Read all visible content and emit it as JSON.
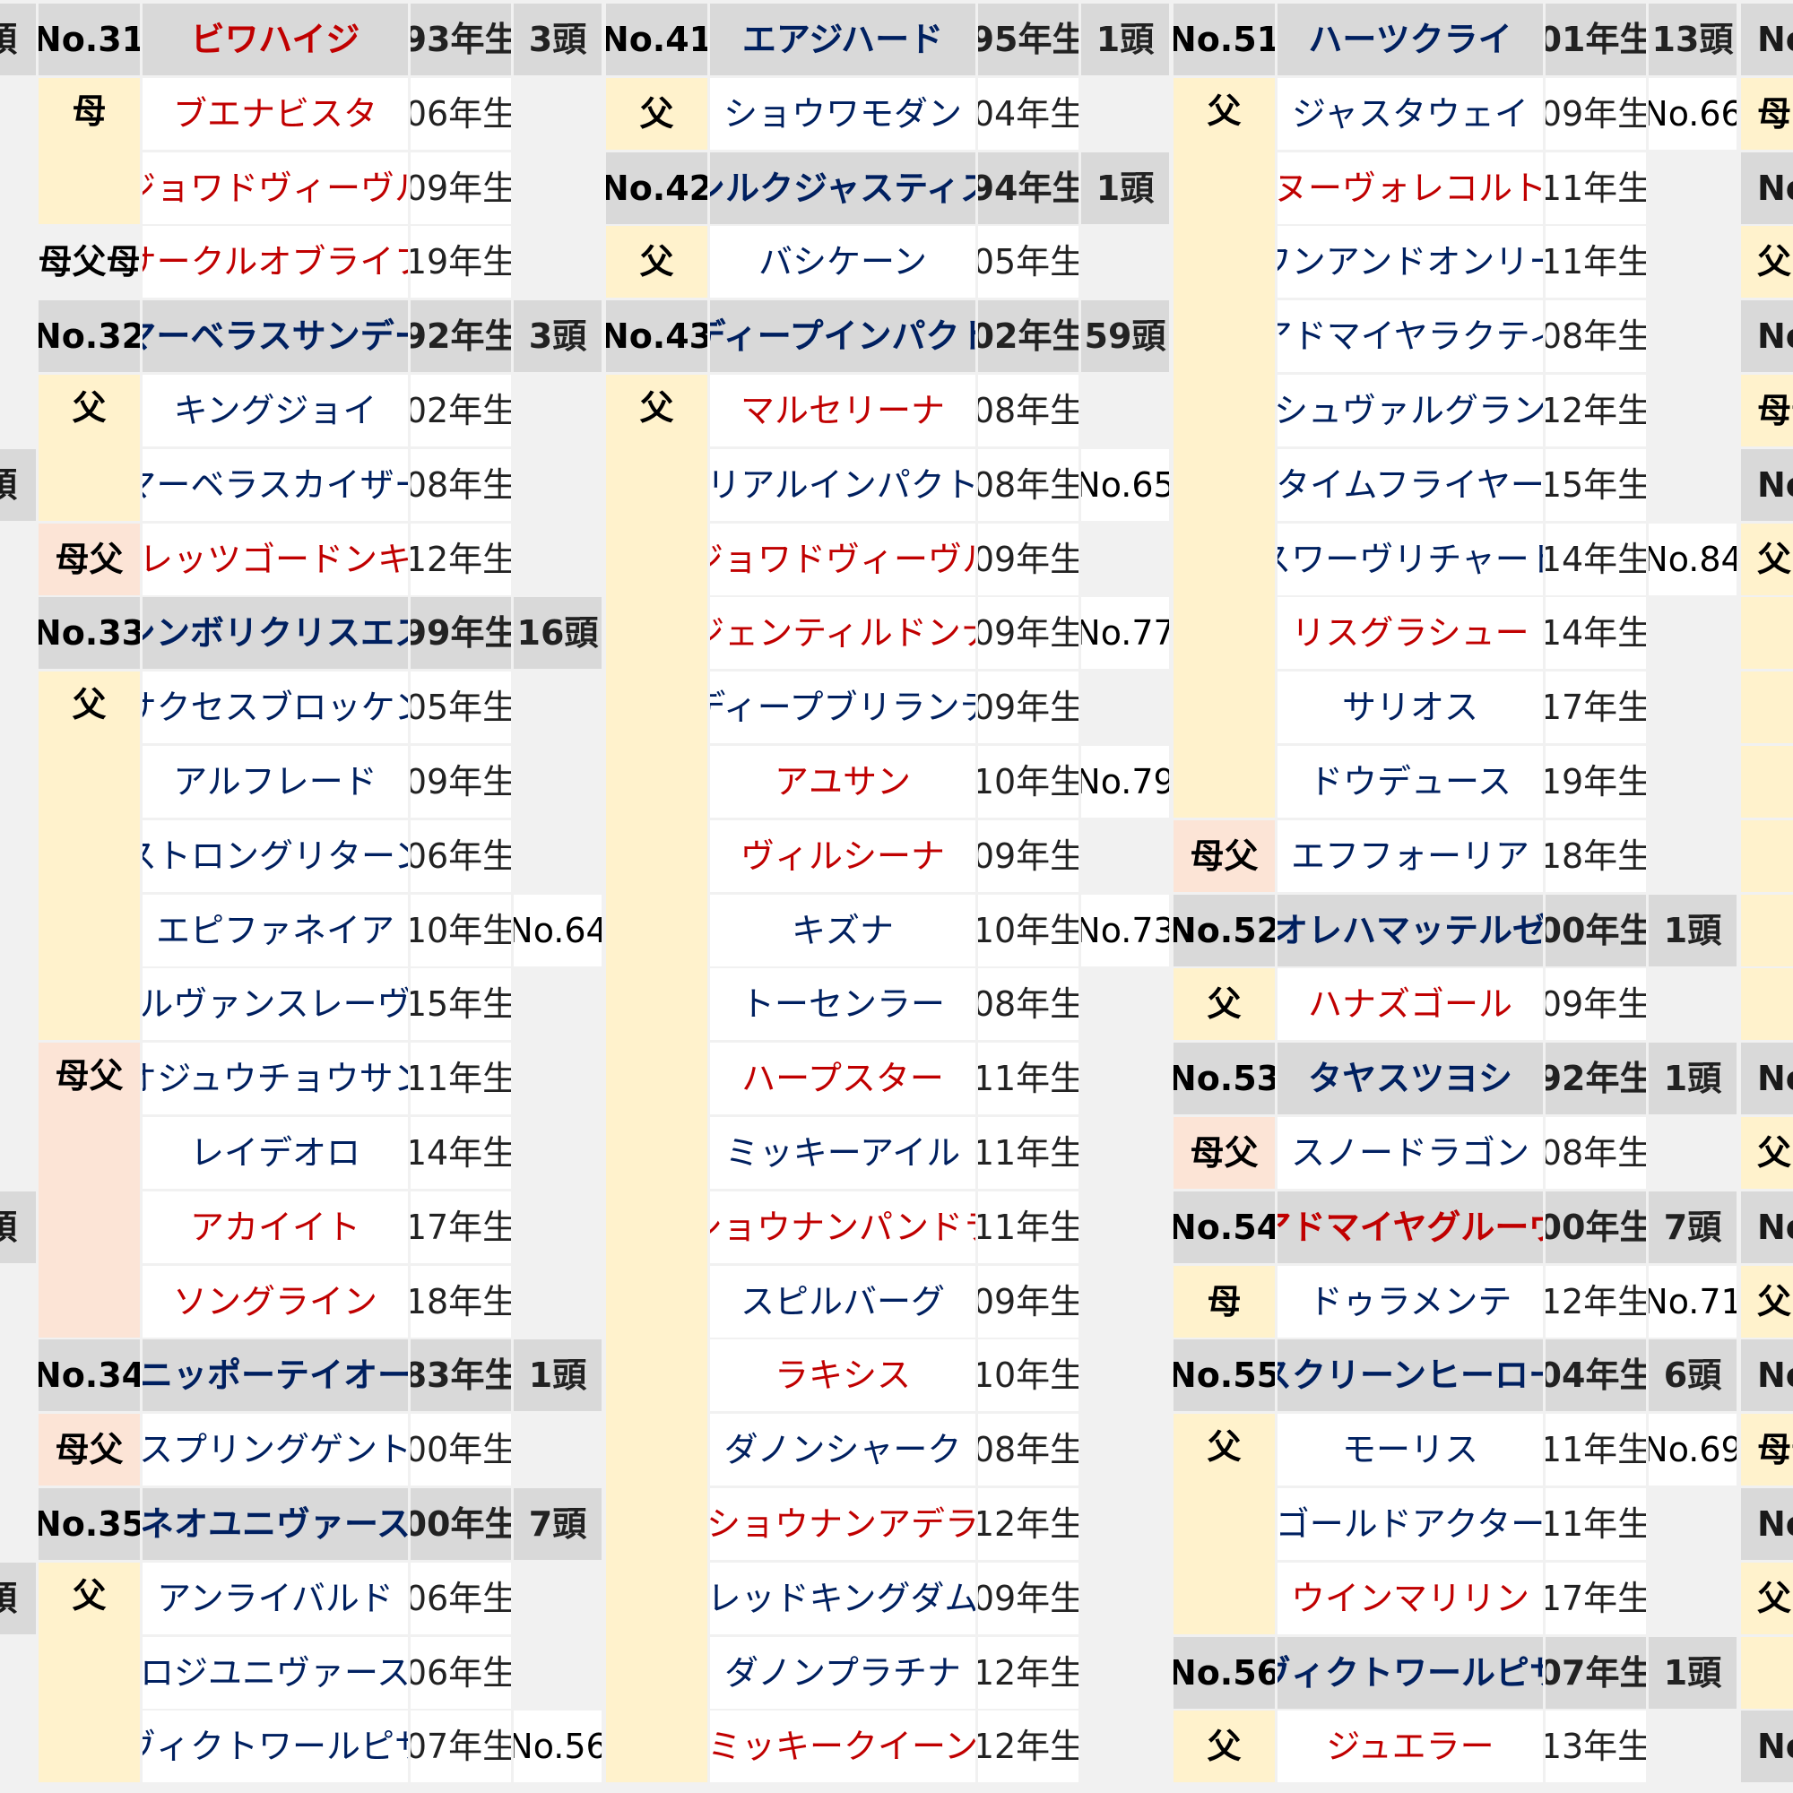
{
  "colors": {
    "blue": "#002060",
    "red": "#c00000",
    "header_bg": "#d9d9d9",
    "sire_bg": "#fff2cc",
    "damsire_bg": "#fce4d6"
  },
  "left_edge": [
    {
      "row": 0,
      "text": "頭"
    },
    {
      "row": 6,
      "text": "頭"
    },
    {
      "row": 16,
      "text": "頭"
    },
    {
      "row": 21,
      "text": "頭"
    }
  ],
  "right_edge": [
    {
      "row": 0,
      "text": "No",
      "kind": "hdr"
    },
    {
      "row": 1,
      "text": "母",
      "kind": "rel"
    },
    {
      "row": 2,
      "text": "No",
      "kind": "hdr"
    },
    {
      "row": 3,
      "text": "父",
      "kind": "rel"
    },
    {
      "row": 4,
      "text": "No",
      "kind": "hdr"
    },
    {
      "row": 5,
      "text": "母母",
      "kind": "rel"
    },
    {
      "row": 6,
      "text": "No",
      "kind": "hdr"
    },
    {
      "row": 7,
      "text": "父",
      "kind": "rel"
    },
    {
      "row": 14,
      "text": "No",
      "kind": "hdr"
    },
    {
      "row": 15,
      "text": "父",
      "kind": "rel"
    },
    {
      "row": 16,
      "text": "No",
      "kind": "hdr"
    },
    {
      "row": 17,
      "text": "父",
      "kind": "rel"
    },
    {
      "row": 18,
      "text": "No",
      "kind": "hdr"
    },
    {
      "row": 19,
      "text": "母母",
      "kind": "rel"
    },
    {
      "row": 20,
      "text": "No",
      "kind": "hdr"
    },
    {
      "row": 21,
      "text": "父",
      "kind": "rel"
    },
    {
      "row": 23,
      "text": "No",
      "kind": "hdr"
    }
  ],
  "columns": [
    {
      "rows": [
        {
          "type": "header",
          "no": "No.31",
          "name": "ビワハイジ",
          "color": "red",
          "year": "93年生",
          "count": "3頭"
        },
        {
          "type": "entry",
          "rel": "母",
          "name": "ブエナビスタ",
          "color": "red",
          "year": "06年生",
          "note": ""
        },
        {
          "type": "entry",
          "rel": "",
          "name": "ジョワドヴィーヴル",
          "color": "red",
          "year": "09年生",
          "note": ""
        },
        {
          "type": "entry",
          "rel": "母父母",
          "name": "サークルオブライフ",
          "color": "red",
          "year": "19年生",
          "note": ""
        },
        {
          "type": "header",
          "no": "No.32",
          "name": "マーベラスサンデー",
          "color": "blue",
          "year": "92年生",
          "count": "3頭"
        },
        {
          "type": "entry",
          "rel": "父",
          "name": "キングジョイ",
          "color": "blue",
          "year": "02年生",
          "note": ""
        },
        {
          "type": "entry",
          "rel": "",
          "name": "マーベラスカイザー",
          "color": "blue",
          "year": "08年生",
          "note": ""
        },
        {
          "type": "entry",
          "rel": "母父",
          "name": "レッツゴードンキ",
          "color": "red",
          "year": "12年生",
          "note": ""
        },
        {
          "type": "header",
          "no": "No.33",
          "name": "シンボリクリスエス",
          "color": "blue",
          "year": "99年生",
          "count": "16頭"
        },
        {
          "type": "entry",
          "rel": "父",
          "name": "サクセスブロッケン",
          "color": "blue",
          "year": "05年生",
          "note": ""
        },
        {
          "type": "entry",
          "rel": "",
          "name": "アルフレード",
          "color": "blue",
          "year": "09年生",
          "note": ""
        },
        {
          "type": "entry",
          "rel": "",
          "name": "ストロングリターン",
          "color": "blue",
          "year": "06年生",
          "note": ""
        },
        {
          "type": "entry",
          "rel": "",
          "name": "エピファネイア",
          "color": "blue",
          "year": "10年生",
          "note": "No.64"
        },
        {
          "type": "entry",
          "rel": "",
          "name": "ルヴァンスレーヴ",
          "color": "blue",
          "year": "15年生",
          "note": ""
        },
        {
          "type": "entry",
          "rel": "母父",
          "name": "オジュウチョウサン",
          "color": "blue",
          "year": "11年生",
          "note": ""
        },
        {
          "type": "entry",
          "rel": "",
          "name": "レイデオロ",
          "color": "blue",
          "year": "14年生",
          "note": ""
        },
        {
          "type": "entry",
          "rel": "",
          "name": "アカイイト",
          "color": "red",
          "year": "17年生",
          "note": ""
        },
        {
          "type": "entry",
          "rel": "",
          "name": "ソングライン",
          "color": "red",
          "year": "18年生",
          "note": ""
        },
        {
          "type": "header",
          "no": "No.34",
          "name": "ニッポーテイオー",
          "color": "blue",
          "year": "83年生",
          "count": "1頭"
        },
        {
          "type": "entry",
          "rel": "母父",
          "name": "スプリングゲント",
          "color": "blue",
          "year": "00年生",
          "note": ""
        },
        {
          "type": "header",
          "no": "No.35",
          "name": "ネオユニヴァース",
          "color": "blue",
          "year": "00年生",
          "count": "7頭"
        },
        {
          "type": "entry",
          "rel": "父",
          "name": "アンライバルド",
          "color": "blue",
          "year": "06年生",
          "note": ""
        },
        {
          "type": "entry",
          "rel": "",
          "name": "ロジユニヴァース",
          "color": "blue",
          "year": "06年生",
          "note": ""
        },
        {
          "type": "entry",
          "rel": "",
          "name": "ヴィクトワールピサ",
          "color": "blue",
          "year": "07年生",
          "note": "No.56"
        }
      ]
    },
    {
      "rows": [
        {
          "type": "header",
          "no": "No.41",
          "name": "エアジハード",
          "color": "blue",
          "year": "95年生",
          "count": "1頭"
        },
        {
          "type": "entry",
          "rel": "父",
          "name": "ショウワモダン",
          "color": "blue",
          "year": "04年生",
          "note": ""
        },
        {
          "type": "header",
          "no": "No.42",
          "name": "シルクジャスティス",
          "color": "blue",
          "year": "94年生",
          "count": "1頭"
        },
        {
          "type": "entry",
          "rel": "父",
          "name": "バシケーン",
          "color": "blue",
          "year": "05年生",
          "note": ""
        },
        {
          "type": "header",
          "no": "No.43",
          "name": "ディープインパクト",
          "color": "blue",
          "year": "02年生",
          "count": "59頭"
        },
        {
          "type": "entry",
          "rel": "父",
          "name": "マルセリーナ",
          "color": "red",
          "year": "08年生",
          "note": ""
        },
        {
          "type": "entry",
          "rel": "",
          "name": "リアルインパクト",
          "color": "blue",
          "year": "08年生",
          "note": "No.65"
        },
        {
          "type": "entry",
          "rel": "",
          "name": "ジョワドヴィーヴル",
          "color": "red",
          "year": "09年生",
          "note": ""
        },
        {
          "type": "entry",
          "rel": "",
          "name": "ジェンティルドンナ",
          "color": "red",
          "year": "09年生",
          "note": "No.77"
        },
        {
          "type": "entry",
          "rel": "",
          "name": "ディープブリランテ",
          "color": "blue",
          "year": "09年生",
          "note": ""
        },
        {
          "type": "entry",
          "rel": "",
          "name": "アユサン",
          "color": "red",
          "year": "10年生",
          "note": "No.79"
        },
        {
          "type": "entry",
          "rel": "",
          "name": "ヴィルシーナ",
          "color": "red",
          "year": "09年生",
          "note": ""
        },
        {
          "type": "entry",
          "rel": "",
          "name": "キズナ",
          "color": "blue",
          "year": "10年生",
          "note": "No.73"
        },
        {
          "type": "entry",
          "rel": "",
          "name": "トーセンラー",
          "color": "blue",
          "year": "08年生",
          "note": ""
        },
        {
          "type": "entry",
          "rel": "",
          "name": "ハープスター",
          "color": "red",
          "year": "11年生",
          "note": ""
        },
        {
          "type": "entry",
          "rel": "",
          "name": "ミッキーアイル",
          "color": "blue",
          "year": "11年生",
          "note": ""
        },
        {
          "type": "entry",
          "rel": "",
          "name": "ショウナンパンドラ",
          "color": "red",
          "year": "11年生",
          "note": ""
        },
        {
          "type": "entry",
          "rel": "",
          "name": "スピルバーグ",
          "color": "blue",
          "year": "09年生",
          "note": ""
        },
        {
          "type": "entry",
          "rel": "",
          "name": "ラキシス",
          "color": "red",
          "year": "10年生",
          "note": ""
        },
        {
          "type": "entry",
          "rel": "",
          "name": "ダノンシャーク",
          "color": "blue",
          "year": "08年生",
          "note": ""
        },
        {
          "type": "entry",
          "rel": "",
          "name": "ショウナンアデラ",
          "color": "red",
          "year": "12年生",
          "note": ""
        },
        {
          "type": "entry",
          "rel": "",
          "name": "レッドキングダム",
          "color": "blue",
          "year": "09年生",
          "note": ""
        },
        {
          "type": "entry",
          "rel": "",
          "name": "ダノンプラチナ",
          "color": "blue",
          "year": "12年生",
          "note": ""
        },
        {
          "type": "entry",
          "rel": "",
          "name": "ミッキークイーン",
          "color": "red",
          "year": "12年生",
          "note": ""
        }
      ]
    },
    {
      "rows": [
        {
          "type": "header",
          "no": "No.51",
          "name": "ハーツクライ",
          "color": "blue",
          "year": "01年生",
          "count": "13頭"
        },
        {
          "type": "entry",
          "rel": "父",
          "name": "ジャスタウェイ",
          "color": "blue",
          "year": "09年生",
          "note": "No.66"
        },
        {
          "type": "entry",
          "rel": "",
          "name": "ヌーヴォレコルト",
          "color": "red",
          "year": "11年生",
          "note": ""
        },
        {
          "type": "entry",
          "rel": "",
          "name": "ワンアンドオンリー",
          "color": "blue",
          "year": "11年生",
          "note": ""
        },
        {
          "type": "entry",
          "rel": "",
          "name": "アドマイヤラクティ",
          "color": "blue",
          "year": "08年生",
          "note": ""
        },
        {
          "type": "entry",
          "rel": "",
          "name": "シュヴァルグラン",
          "color": "blue",
          "year": "12年生",
          "note": ""
        },
        {
          "type": "entry",
          "rel": "",
          "name": "タイムフライヤー",
          "color": "blue",
          "year": "15年生",
          "note": ""
        },
        {
          "type": "entry",
          "rel": "",
          "name": "スワーヴリチャード",
          "color": "blue",
          "year": "14年生",
          "note": "No.84"
        },
        {
          "type": "entry",
          "rel": "",
          "name": "リスグラシュー",
          "color": "red",
          "year": "14年生",
          "note": ""
        },
        {
          "type": "entry",
          "rel": "",
          "name": "サリオス",
          "color": "blue",
          "year": "17年生",
          "note": ""
        },
        {
          "type": "entry",
          "rel": "",
          "name": "ドウデュース",
          "color": "blue",
          "year": "19年生",
          "note": ""
        },
        {
          "type": "entry",
          "rel": "母父",
          "name": "エフフォーリア",
          "color": "blue",
          "year": "18年生",
          "note": ""
        },
        {
          "type": "header",
          "no": "No.52",
          "name": "オレハマッテルゼ",
          "color": "blue",
          "year": "00年生",
          "count": "1頭"
        },
        {
          "type": "entry",
          "rel": "父",
          "name": "ハナズゴール",
          "color": "red",
          "year": "09年生",
          "note": ""
        },
        {
          "type": "header",
          "no": "No.53",
          "name": "タヤスツヨシ",
          "color": "blue",
          "year": "92年生",
          "count": "1頭"
        },
        {
          "type": "entry",
          "rel": "母父",
          "name": "スノードラゴン",
          "color": "blue",
          "year": "08年生",
          "note": ""
        },
        {
          "type": "header",
          "no": "No.54",
          "name": "アドマイヤグルーヴ",
          "color": "red",
          "year": "00年生",
          "count": "7頭"
        },
        {
          "type": "entry",
          "rel": "母",
          "name": "ドゥラメンテ",
          "color": "blue",
          "year": "12年生",
          "note": "No.71"
        },
        {
          "type": "header",
          "no": "No.55",
          "name": "スクリーンヒーロー",
          "color": "blue",
          "year": "04年生",
          "count": "6頭"
        },
        {
          "type": "entry",
          "rel": "父",
          "name": "モーリス",
          "color": "blue",
          "year": "11年生",
          "note": "No.69"
        },
        {
          "type": "entry",
          "rel": "",
          "name": "ゴールドアクター",
          "color": "blue",
          "year": "11年生",
          "note": ""
        },
        {
          "type": "entry",
          "rel": "",
          "name": "ウインマリリン",
          "color": "red",
          "year": "17年生",
          "note": ""
        },
        {
          "type": "header",
          "no": "No.56",
          "name": "ヴィクトワールピサ",
          "color": "blue",
          "year": "07年生",
          "count": "1頭"
        },
        {
          "type": "entry",
          "rel": "父",
          "name": "ジュエラー",
          "color": "red",
          "year": "13年生",
          "note": ""
        }
      ]
    }
  ]
}
